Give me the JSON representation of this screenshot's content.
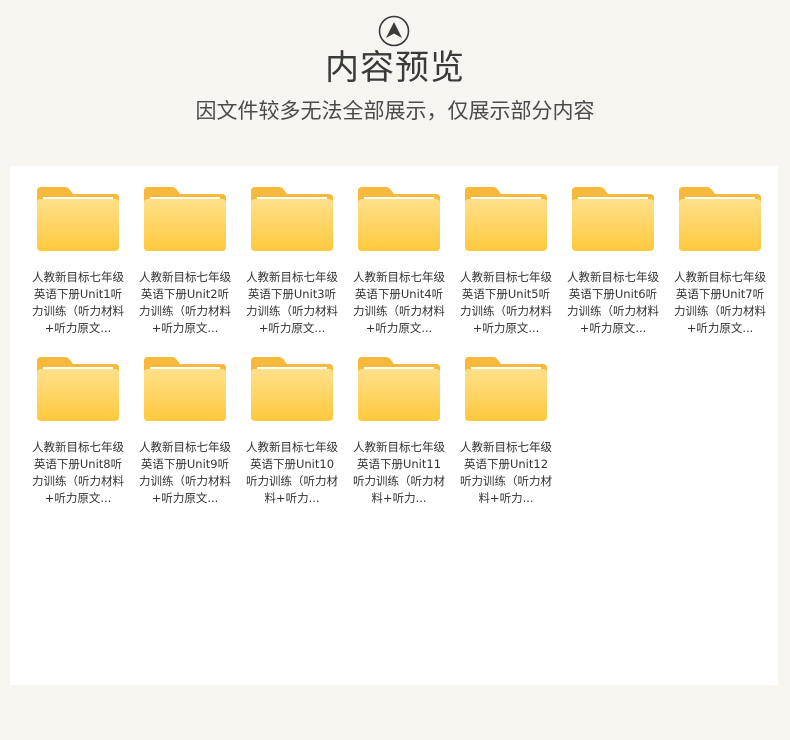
{
  "header": {
    "title": "内容预览",
    "subtitle": "因文件较多无法全部展示，仅展示部分内容"
  },
  "colors": {
    "page_bg": "#f7f5f0",
    "panel_bg": "#ffffff",
    "folder_front": "#ffd466",
    "folder_back": "#f6b93b",
    "text": "#333333"
  },
  "files": [
    {
      "name": "人教新目标七年级英语下册Unit1听力训练（听力材料+听力原文..."
    },
    {
      "name": "人教新目标七年级英语下册Unit2听力训练（听力材料+听力原文..."
    },
    {
      "name": "人教新目标七年级英语下册Unit3听力训练（听力材料+听力原文..."
    },
    {
      "name": "人教新目标七年级英语下册Unit4听力训练（听力材料+听力原文..."
    },
    {
      "name": "人教新目标七年级英语下册Unit5听力训练（听力材料+听力原文..."
    },
    {
      "name": "人教新目标七年级英语下册Unit6听力训练（听力材料+听力原文..."
    },
    {
      "name": "人教新目标七年级英语下册Unit7听力训练（听力材料+听力原文..."
    },
    {
      "name": "人教新目标七年级英语下册Unit8听力训练（听力材料+听力原文..."
    },
    {
      "name": "人教新目标七年级英语下册Unit9听力训练（听力材料+听力原文..."
    },
    {
      "name": "人教新目标七年级英语下册Unit10听力训练（听力材料+听力..."
    },
    {
      "name": "人教新目标七年级英语下册Unit11听力训练（听力材料+听力..."
    },
    {
      "name": "人教新目标七年级英语下册Unit12听力训练（听力材料+听力..."
    }
  ]
}
